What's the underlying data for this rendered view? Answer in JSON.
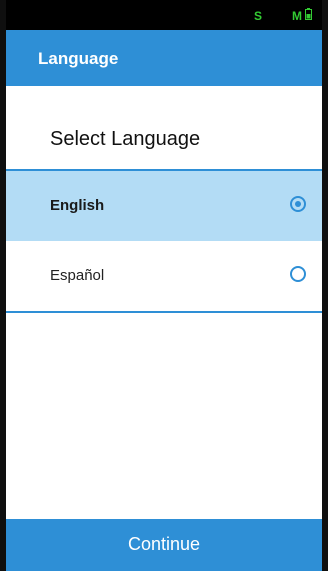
{
  "status_bar": {
    "left_indicator": "S",
    "right_indicator": "M",
    "battery_icon": "battery-icon"
  },
  "app_bar": {
    "title": "Language"
  },
  "screen": {
    "heading": "Select Language"
  },
  "languages": [
    {
      "label": "English",
      "selected": true
    },
    {
      "label": "Español",
      "selected": false
    }
  ],
  "footer": {
    "continue_label": "Continue"
  },
  "colors": {
    "accent": "#2e8fd6",
    "selected_row": "#b3dcf5",
    "status_text": "#33cc33"
  }
}
